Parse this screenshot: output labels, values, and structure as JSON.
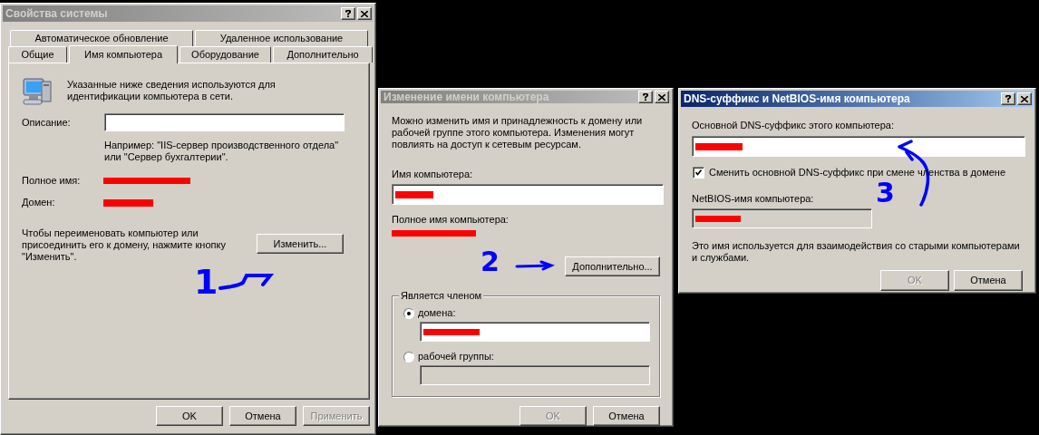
{
  "system_properties": {
    "title": "Свойства системы",
    "active": false,
    "tab_rows": [
      {
        "tabs": [
          {
            "label": "Автоматическое обновление",
            "selected": false
          },
          {
            "label": "Удаленное использование",
            "selected": false
          }
        ]
      },
      {
        "tabs": [
          {
            "label": "Общие",
            "selected": false
          },
          {
            "label": "Имя компьютера",
            "selected": true
          },
          {
            "label": "Оборудование",
            "selected": false
          },
          {
            "label": "Дополнительно",
            "selected": false
          }
        ]
      }
    ],
    "intro": "Указанные ниже сведения используются для\nидентификации компьютера в сети.",
    "description_label": "Описание:",
    "description_hint": "Например: \"IIS-сервер производственного отдела\"\nили \"Сервер бухгалтерии\".",
    "full_name": {
      "label": "Полное имя:",
      "redacted": true
    },
    "domain": {
      "label": "Домен:",
      "redacted": true
    },
    "rename_text": "Чтобы переименовать компьютер или\nприсоединить его к домену, нажмите кнопку\n\"Изменить\".",
    "change_button": {
      "label": "Изменить...",
      "disabled": false
    },
    "buttons": [
      {
        "label": "OK",
        "disabled": false
      },
      {
        "label": "Отмена",
        "disabled": false
      },
      {
        "label": "Применить",
        "disabled": true
      }
    ]
  },
  "rename_dialog": {
    "title": "Изменение имени компьютера",
    "active": false,
    "intro": "Можно изменить имя и принадлежность к домену или\nрабочей группе этого компьютера. Изменения могут\nповлиять на доступ к сетевым ресурсам.",
    "name_label": "Имя компьютера:",
    "name_field": {
      "redacted": true,
      "disabled": false
    },
    "full_name_label": "Полное имя компьютера:",
    "full_name": {
      "redacted": true
    },
    "more_button": {
      "label": "Дополнительно...",
      "disabled": false
    },
    "membership": {
      "legend": "Является членом",
      "options": [
        {
          "label": "домена:",
          "selected": true,
          "field": {
            "redacted": true,
            "disabled": false
          }
        },
        {
          "label": "рабочей группы:",
          "selected": false,
          "field": {
            "disabled": true
          }
        }
      ]
    },
    "buttons": [
      {
        "label": "OK",
        "disabled": true
      },
      {
        "label": "Отмена",
        "disabled": false
      }
    ]
  },
  "dns_dialog": {
    "title": "DNS-суффикс и NetBIOS-имя компьютера",
    "active": true,
    "suffix_label": "Основной DNS-суффикс этого компьютера:",
    "suffix_field": {
      "redacted": true,
      "disabled": false
    },
    "change_suffix": {
      "label": "Сменить основной DNS-суффикс при смене членства в домене",
      "checked": true
    },
    "netbios_label": "NetBIOS-имя компьютера:",
    "netbios_field": {
      "redacted": true,
      "disabled": true
    },
    "note": "Это имя используется для взаимодействия со старыми компьютерами\nи службами.",
    "buttons": [
      {
        "label": "OK",
        "disabled": true
      },
      {
        "label": "Отмена",
        "disabled": false
      }
    ]
  },
  "annotations": [
    {
      "number": "1"
    },
    {
      "number": "2"
    },
    {
      "number": "3"
    }
  ]
}
